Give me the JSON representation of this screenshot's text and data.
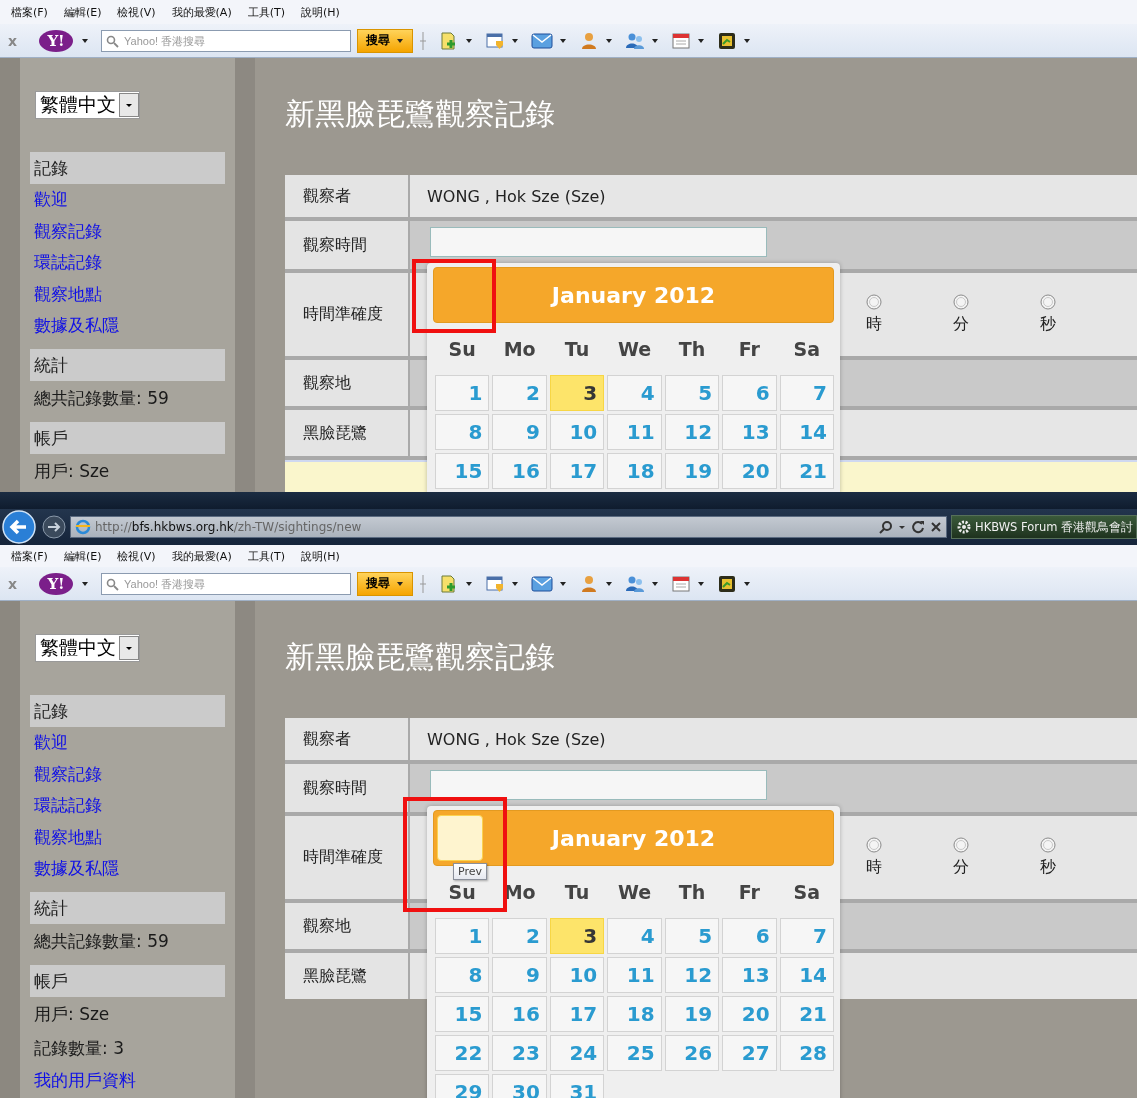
{
  "panes": [
    {
      "menu": [
        "檔案(F)",
        "編輯(E)",
        "檢視(V)",
        "我的最愛(A)",
        "工具(T)",
        "說明(H)"
      ],
      "toolbar": {
        "close": "x",
        "logo": "Y!",
        "search_placeholder": "Yahoo! 香港搜尋",
        "search_button": "搜尋"
      },
      "language": "繁體中文",
      "sidebar": [
        {
          "heading": "記錄",
          "items": [
            {
              "kind": "link",
              "text": "歡迎"
            },
            {
              "kind": "link",
              "text": "觀察記錄"
            },
            {
              "kind": "link",
              "text": "環誌記錄"
            },
            {
              "kind": "link",
              "text": "觀察地點"
            },
            {
              "kind": "link",
              "text": "數據及私隱"
            }
          ]
        },
        {
          "heading": "統計",
          "items": [
            {
              "kind": "text",
              "text": "總共記錄數量: 59"
            }
          ]
        },
        {
          "heading": "帳戶",
          "items": [
            {
              "kind": "text",
              "text": "用戶: Sze"
            }
          ]
        }
      ],
      "title": "新黑臉琵鷺觀察記錄",
      "form": [
        {
          "kind": "text",
          "label": "觀察者",
          "value": "WONG , Hok Sze (Sze)"
        },
        {
          "kind": "input",
          "label": "觀察時間"
        },
        {
          "kind": "radios",
          "label": "時間準確度",
          "options": [
            {
              "label": "時",
              "checked": false
            },
            {
              "label": "分",
              "checked": false
            },
            {
              "label": "秒",
              "checked": false
            }
          ]
        },
        {
          "kind": "blank",
          "label": "觀察地"
        },
        {
          "kind": "blank",
          "label": "黑臉琵鷺"
        },
        {
          "kind": "highlight"
        }
      ],
      "calendar": {
        "title": "January 2012",
        "prev_hovered": false,
        "weekdays": [
          "Su",
          "Mo",
          "Tu",
          "We",
          "Th",
          "Fr",
          "Sa"
        ],
        "days": [
          {
            "label": "1",
            "selected": false
          },
          {
            "label": "2",
            "selected": false
          },
          {
            "label": "3",
            "selected": true
          },
          {
            "label": "4",
            "selected": false
          },
          {
            "label": "5",
            "selected": false
          },
          {
            "label": "6",
            "selected": false
          },
          {
            "label": "7",
            "selected": false
          },
          {
            "label": "8",
            "selected": false
          },
          {
            "label": "9",
            "selected": false
          },
          {
            "label": "10",
            "selected": false
          },
          {
            "label": "11",
            "selected": false
          },
          {
            "label": "12",
            "selected": false
          },
          {
            "label": "13",
            "selected": false
          },
          {
            "label": "14",
            "selected": false
          },
          {
            "label": "15",
            "selected": false
          },
          {
            "label": "16",
            "selected": false
          },
          {
            "label": "17",
            "selected": false
          },
          {
            "label": "18",
            "selected": false
          },
          {
            "label": "19",
            "selected": false
          },
          {
            "label": "20",
            "selected": false
          },
          {
            "label": "21",
            "selected": false
          }
        ]
      }
    },
    {
      "menu": [
        "檔案(F)",
        "編輯(E)",
        "檢視(V)",
        "我的最愛(A)",
        "工具(T)",
        "說明(H)"
      ],
      "toolbar": {
        "close": "x",
        "logo": "Y!",
        "search_placeholder": "Yahoo! 香港搜尋",
        "search_button": "搜尋"
      },
      "language": "繁體中文",
      "sidebar": [
        {
          "heading": "記錄",
          "items": [
            {
              "kind": "link",
              "text": "歡迎"
            },
            {
              "kind": "link",
              "text": "觀察記錄"
            },
            {
              "kind": "link",
              "text": "環誌記錄"
            },
            {
              "kind": "link",
              "text": "觀察地點"
            },
            {
              "kind": "link",
              "text": "數據及私隱"
            }
          ]
        },
        {
          "heading": "統計",
          "items": [
            {
              "kind": "text",
              "text": "總共記錄數量: 59"
            }
          ]
        },
        {
          "heading": "帳戶",
          "items": [
            {
              "kind": "text",
              "text": "用戶: Sze"
            },
            {
              "kind": "text",
              "text": "記錄數量: 3"
            },
            {
              "kind": "link",
              "text": "我的用戶資料"
            }
          ]
        }
      ],
      "title": "新黑臉琵鷺觀察記錄",
      "form": [
        {
          "kind": "text",
          "label": "觀察者",
          "value": "WONG , Hok Sze (Sze)"
        },
        {
          "kind": "input",
          "label": "觀察時間"
        },
        {
          "kind": "radios",
          "label": "時間準確度",
          "options": [
            {
              "label": "時",
              "checked": false
            },
            {
              "label": "分",
              "checked": false
            },
            {
              "label": "秒",
              "checked": false
            }
          ]
        },
        {
          "kind": "blank",
          "label": "觀察地"
        },
        {
          "kind": "blank",
          "label": "黑臉琵鷺"
        }
      ],
      "calendar": {
        "title": "January 2012",
        "prev_hovered": true,
        "tooltip": "Prev",
        "weekdays": [
          "Su",
          "Mo",
          "Tu",
          "We",
          "Th",
          "Fr",
          "Sa"
        ],
        "days": [
          {
            "label": "1",
            "selected": false
          },
          {
            "label": "2",
            "selected": false
          },
          {
            "label": "3",
            "selected": true
          },
          {
            "label": "4",
            "selected": false
          },
          {
            "label": "5",
            "selected": false
          },
          {
            "label": "6",
            "selected": false
          },
          {
            "label": "7",
            "selected": false
          },
          {
            "label": "8",
            "selected": false
          },
          {
            "label": "9",
            "selected": false
          },
          {
            "label": "10",
            "selected": false
          },
          {
            "label": "11",
            "selected": false
          },
          {
            "label": "12",
            "selected": false
          },
          {
            "label": "13",
            "selected": false
          },
          {
            "label": "14",
            "selected": false
          },
          {
            "label": "15",
            "selected": false
          },
          {
            "label": "16",
            "selected": false
          },
          {
            "label": "17",
            "selected": false
          },
          {
            "label": "18",
            "selected": false
          },
          {
            "label": "19",
            "selected": false
          },
          {
            "label": "20",
            "selected": false
          },
          {
            "label": "21",
            "selected": false
          },
          {
            "label": "22",
            "selected": false
          },
          {
            "label": "23",
            "selected": false
          },
          {
            "label": "24",
            "selected": false
          },
          {
            "label": "25",
            "selected": false
          },
          {
            "label": "26",
            "selected": false
          },
          {
            "label": "27",
            "selected": false
          },
          {
            "label": "28",
            "selected": false
          },
          {
            "label": "29",
            "selected": false
          },
          {
            "label": "30",
            "selected": false
          },
          {
            "label": "31",
            "selected": false
          }
        ]
      }
    }
  ],
  "browser_bar": {
    "url": "http://**bfs.hkbws.org.hk**/zh-TW/sightings/new",
    "tab": "HKBWS Forum 香港觀鳥會討"
  }
}
